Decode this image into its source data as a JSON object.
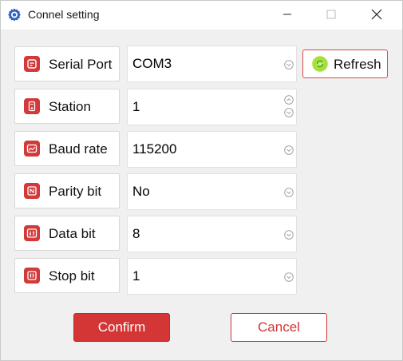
{
  "window": {
    "title": "Connel setting",
    "icon": "gear-icon",
    "controls": {
      "minimize": "minimize-icon",
      "maximize": "maximize-icon",
      "close": "close-icon"
    }
  },
  "colors": {
    "accent": "#d43535",
    "refresh_glow": "#9cdc2c"
  },
  "rows": [
    {
      "label": "Serial Port",
      "icon": "serial-port-icon",
      "value": "COM3",
      "control": "dropdown"
    },
    {
      "label": "Station",
      "icon": "station-icon",
      "value": "1",
      "control": "spinner"
    },
    {
      "label": "Baud rate",
      "icon": "baud-rate-icon",
      "value": "115200",
      "control": "dropdown"
    },
    {
      "label": "Parity bit",
      "icon": "parity-bit-icon",
      "value": "No",
      "control": "dropdown"
    },
    {
      "label": "Data bit",
      "icon": "data-bit-icon",
      "value": "8",
      "control": "dropdown"
    },
    {
      "label": "Stop bit",
      "icon": "stop-bit-icon",
      "value": "1",
      "control": "dropdown"
    }
  ],
  "refresh": {
    "label": "Refresh",
    "icon": "refresh-icon"
  },
  "actions": {
    "confirm": "Confirm",
    "cancel": "Cancel"
  }
}
